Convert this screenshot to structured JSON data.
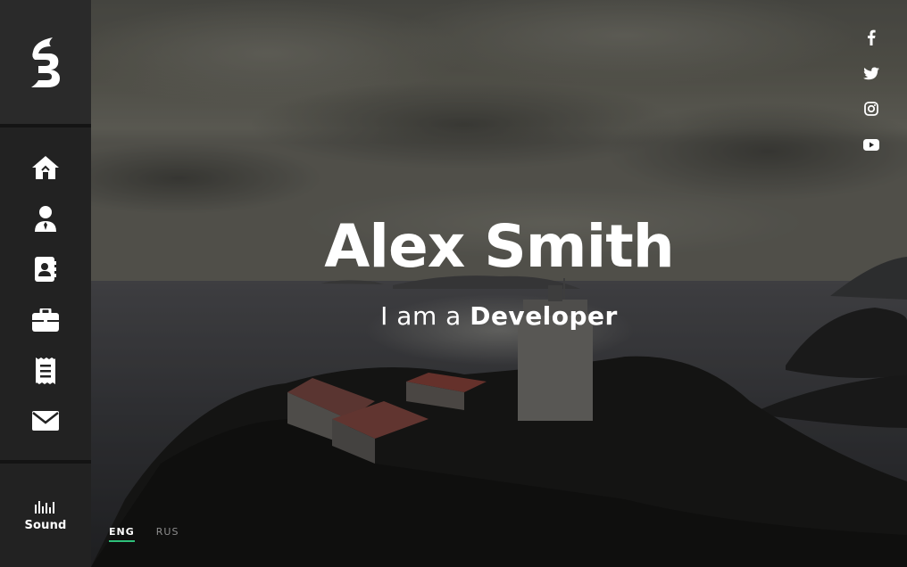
{
  "hero": {
    "name": "Alex Smith",
    "subtitle_prefix": "I am a ",
    "subtitle_role": "Developer"
  },
  "sidebar": {
    "logo_icon": "brand-b-logo-icon",
    "nav": [
      {
        "id": "home",
        "icon": "home-icon"
      },
      {
        "id": "about",
        "icon": "user-tie-icon"
      },
      {
        "id": "resume",
        "icon": "address-book-icon"
      },
      {
        "id": "portfolio",
        "icon": "briefcase-icon"
      },
      {
        "id": "blog",
        "icon": "receipt-icon"
      },
      {
        "id": "contact",
        "icon": "envelope-icon"
      }
    ],
    "sound_label": "Sound",
    "sound_icon": "equalizer-icon"
  },
  "social": [
    {
      "id": "facebook",
      "icon": "facebook-icon"
    },
    {
      "id": "twitter",
      "icon": "twitter-icon"
    },
    {
      "id": "instagram",
      "icon": "instagram-icon"
    },
    {
      "id": "youtube",
      "icon": "youtube-icon"
    }
  ],
  "languages": [
    {
      "label": "ENG",
      "active": true
    },
    {
      "label": "RUS",
      "active": false
    }
  ],
  "colors": {
    "sidebar_bg": "#222222",
    "logo_bg": "#2a2a2a",
    "accent": "#2ec07a",
    "text": "#ffffff",
    "muted": "#8d8d8d"
  }
}
